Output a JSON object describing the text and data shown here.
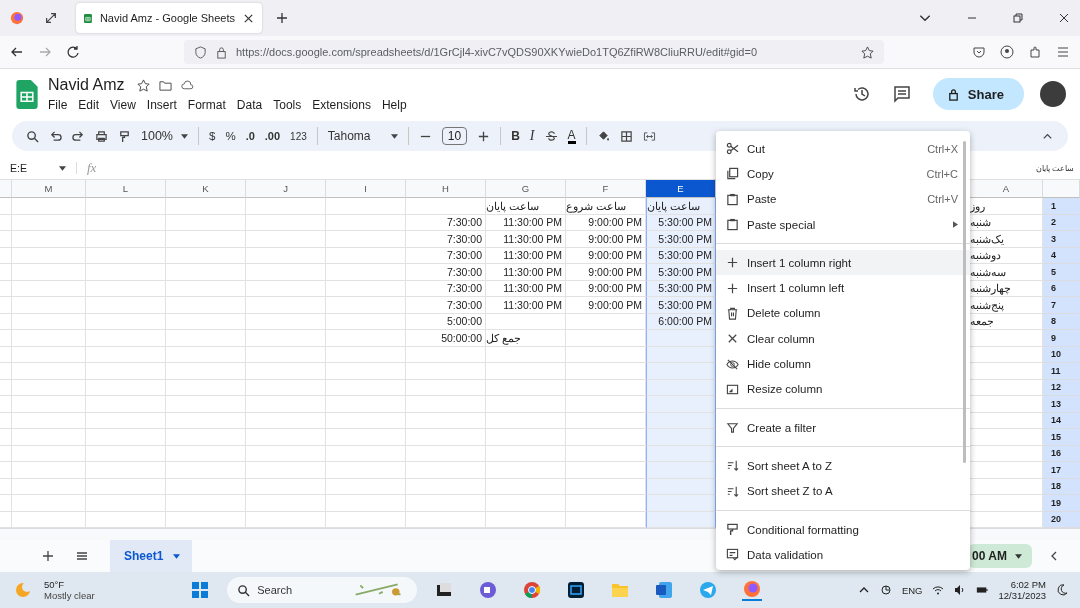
{
  "browser": {
    "tab_title": "Navid Amz - Google Sheets",
    "url": "https://docs.google.com/spreadsheets/d/1GrCjl4-xivC7vQDS90XKYwieDo1TQ6ZfiRW8CliuRRU/edit#gid=0"
  },
  "doc": {
    "title": "Navid Amz",
    "menu": [
      "File",
      "Edit",
      "View",
      "Insert",
      "Format",
      "Data",
      "Tools",
      "Extensions",
      "Help"
    ],
    "share": "Share"
  },
  "toolbar": {
    "zoom": "100%",
    "currency": "$",
    "percent": "%",
    "decrease_decimal": ".0",
    "increase_decimal": ".00",
    "number_format": "123",
    "font": "Tahoma",
    "font_size": "10",
    "bold": "B",
    "italic": "I",
    "text_color": "A"
  },
  "formula_bar": {
    "name_box": "E:E",
    "fx": "fx",
    "overflow_text": "ساعت پایان"
  },
  "grid": {
    "columns": [
      {
        "label": "M",
        "selected": false
      },
      {
        "label": "L",
        "selected": false
      },
      {
        "label": "K",
        "selected": false
      },
      {
        "label": "J",
        "selected": false
      },
      {
        "label": "I",
        "selected": false
      },
      {
        "label": "H",
        "selected": false
      },
      {
        "label": "G",
        "selected": false
      },
      {
        "label": "F",
        "selected": false
      },
      {
        "label": "E",
        "selected": true
      },
      {
        "label": "A",
        "selected": false
      }
    ],
    "rows": [
      {
        "number": "1",
        "cells": [
          null,
          null,
          null,
          null,
          null,
          null,
          "ساعت پایان",
          "ساعت شروع",
          "ساعت پایان",
          "روز"
        ]
      },
      {
        "number": "2",
        "cells": [
          null,
          null,
          null,
          null,
          null,
          "7:30:00",
          "11:30:00 PM",
          "9:00:00 PM",
          "5:30:00 PM",
          "شنبه"
        ]
      },
      {
        "number": "3",
        "cells": [
          null,
          null,
          null,
          null,
          null,
          "7:30:00",
          "11:30:00 PM",
          "9:00:00 PM",
          "5:30:00 PM",
          "یک‌شنبه"
        ]
      },
      {
        "number": "4",
        "cells": [
          null,
          null,
          null,
          null,
          null,
          "7:30:00",
          "11:30:00 PM",
          "9:00:00 PM",
          "5:30:00 PM",
          "دوشنبه"
        ]
      },
      {
        "number": "5",
        "cells": [
          null,
          null,
          null,
          null,
          null,
          "7:30:00",
          "11:30:00 PM",
          "9:00:00 PM",
          "5:30:00 PM",
          "سه‌شنبه"
        ]
      },
      {
        "number": "6",
        "cells": [
          null,
          null,
          null,
          null,
          null,
          "7:30:00",
          "11:30:00 PM",
          "9:00:00 PM",
          "5:30:00 PM",
          "چهارشنبه"
        ]
      },
      {
        "number": "7",
        "cells": [
          null,
          null,
          null,
          null,
          null,
          "7:30:00",
          "11:30:00 PM",
          "9:00:00 PM",
          "5:30:00 PM",
          "پنج‌شنبه"
        ]
      },
      {
        "number": "8",
        "cells": [
          null,
          null,
          null,
          null,
          null,
          "5:00:00",
          null,
          null,
          "6:00:00 PM",
          "جمعه"
        ]
      },
      {
        "number": "9",
        "cells": [
          null,
          null,
          null,
          null,
          null,
          "50:00:00",
          "جمع کل",
          null,
          null,
          null
        ]
      },
      {
        "number": "10",
        "cells": [
          null,
          null,
          null,
          null,
          null,
          null,
          null,
          null,
          null,
          null
        ]
      },
      {
        "number": "11",
        "cells": [
          null,
          null,
          null,
          null,
          null,
          null,
          null,
          null,
          null,
          null
        ]
      },
      {
        "number": "12",
        "cells": [
          null,
          null,
          null,
          null,
          null,
          null,
          null,
          null,
          null,
          null
        ]
      },
      {
        "number": "13",
        "cells": [
          null,
          null,
          null,
          null,
          null,
          null,
          null,
          null,
          null,
          null
        ]
      },
      {
        "number": "14",
        "cells": [
          null,
          null,
          null,
          null,
          null,
          null,
          null,
          null,
          null,
          null
        ]
      },
      {
        "number": "15",
        "cells": [
          null,
          null,
          null,
          null,
          null,
          null,
          null,
          null,
          null,
          null
        ]
      },
      {
        "number": "16",
        "cells": [
          null,
          null,
          null,
          null,
          null,
          null,
          null,
          null,
          null,
          null
        ]
      },
      {
        "number": "17",
        "cells": [
          null,
          null,
          null,
          null,
          null,
          null,
          null,
          null,
          null,
          null
        ]
      },
      {
        "number": "18",
        "cells": [
          null,
          null,
          null,
          null,
          null,
          null,
          null,
          null,
          null,
          null
        ]
      },
      {
        "number": "19",
        "cells": [
          null,
          null,
          null,
          null,
          null,
          null,
          null,
          null,
          null,
          null
        ]
      },
      {
        "number": "20",
        "cells": [
          null,
          null,
          null,
          null,
          null,
          null,
          null,
          null,
          null,
          null
        ]
      }
    ]
  },
  "context_menu": [
    [
      {
        "kind": "cut",
        "label": "Cut",
        "shortcut": "Ctrl+X",
        "highlighted": false,
        "submenu": false
      },
      {
        "kind": "copy",
        "label": "Copy",
        "shortcut": "Ctrl+C",
        "highlighted": false,
        "submenu": false
      },
      {
        "kind": "paste",
        "label": "Paste",
        "shortcut": "Ctrl+V",
        "highlighted": false,
        "submenu": false
      },
      {
        "kind": "paste",
        "label": "Paste special",
        "highlighted": false,
        "submenu": true
      }
    ],
    [
      {
        "kind": "plus",
        "label": "Insert 1 column right",
        "highlighted": true,
        "submenu": false
      },
      {
        "kind": "plus",
        "label": "Insert 1 column left",
        "highlighted": false,
        "submenu": false
      },
      {
        "kind": "trash",
        "label": "Delete column",
        "highlighted": false,
        "submenu": false
      },
      {
        "kind": "clear",
        "label": "Clear column",
        "highlighted": false,
        "submenu": false
      },
      {
        "kind": "hide",
        "label": "Hide column",
        "highlighted": false,
        "submenu": false
      },
      {
        "kind": "resize",
        "label": "Resize column",
        "highlighted": false,
        "submenu": false
      }
    ],
    [
      {
        "kind": "filter",
        "label": "Create a filter",
        "highlighted": false,
        "submenu": false
      }
    ],
    [
      {
        "kind": "sort",
        "label": "Sort sheet A to Z",
        "highlighted": false,
        "submenu": false
      },
      {
        "kind": "sort",
        "label": "Sort sheet Z to A",
        "highlighted": false,
        "submenu": false
      }
    ],
    [
      {
        "kind": "conditional",
        "label": "Conditional formatting",
        "highlighted": false,
        "submenu": false
      },
      {
        "kind": "validation",
        "label": "Data validation",
        "highlighted": false,
        "submenu": false
      }
    ]
  ],
  "sheet_bar": {
    "tabs": [
      {
        "label": "Sheet1",
        "selected": true
      }
    ],
    "badge": "00 AM"
  },
  "taskbar": {
    "temperature": "50°F",
    "weather": "Mostly clear",
    "search": "Search",
    "language": "ENG",
    "time": "6:02 PM",
    "date": "12/31/2023"
  }
}
